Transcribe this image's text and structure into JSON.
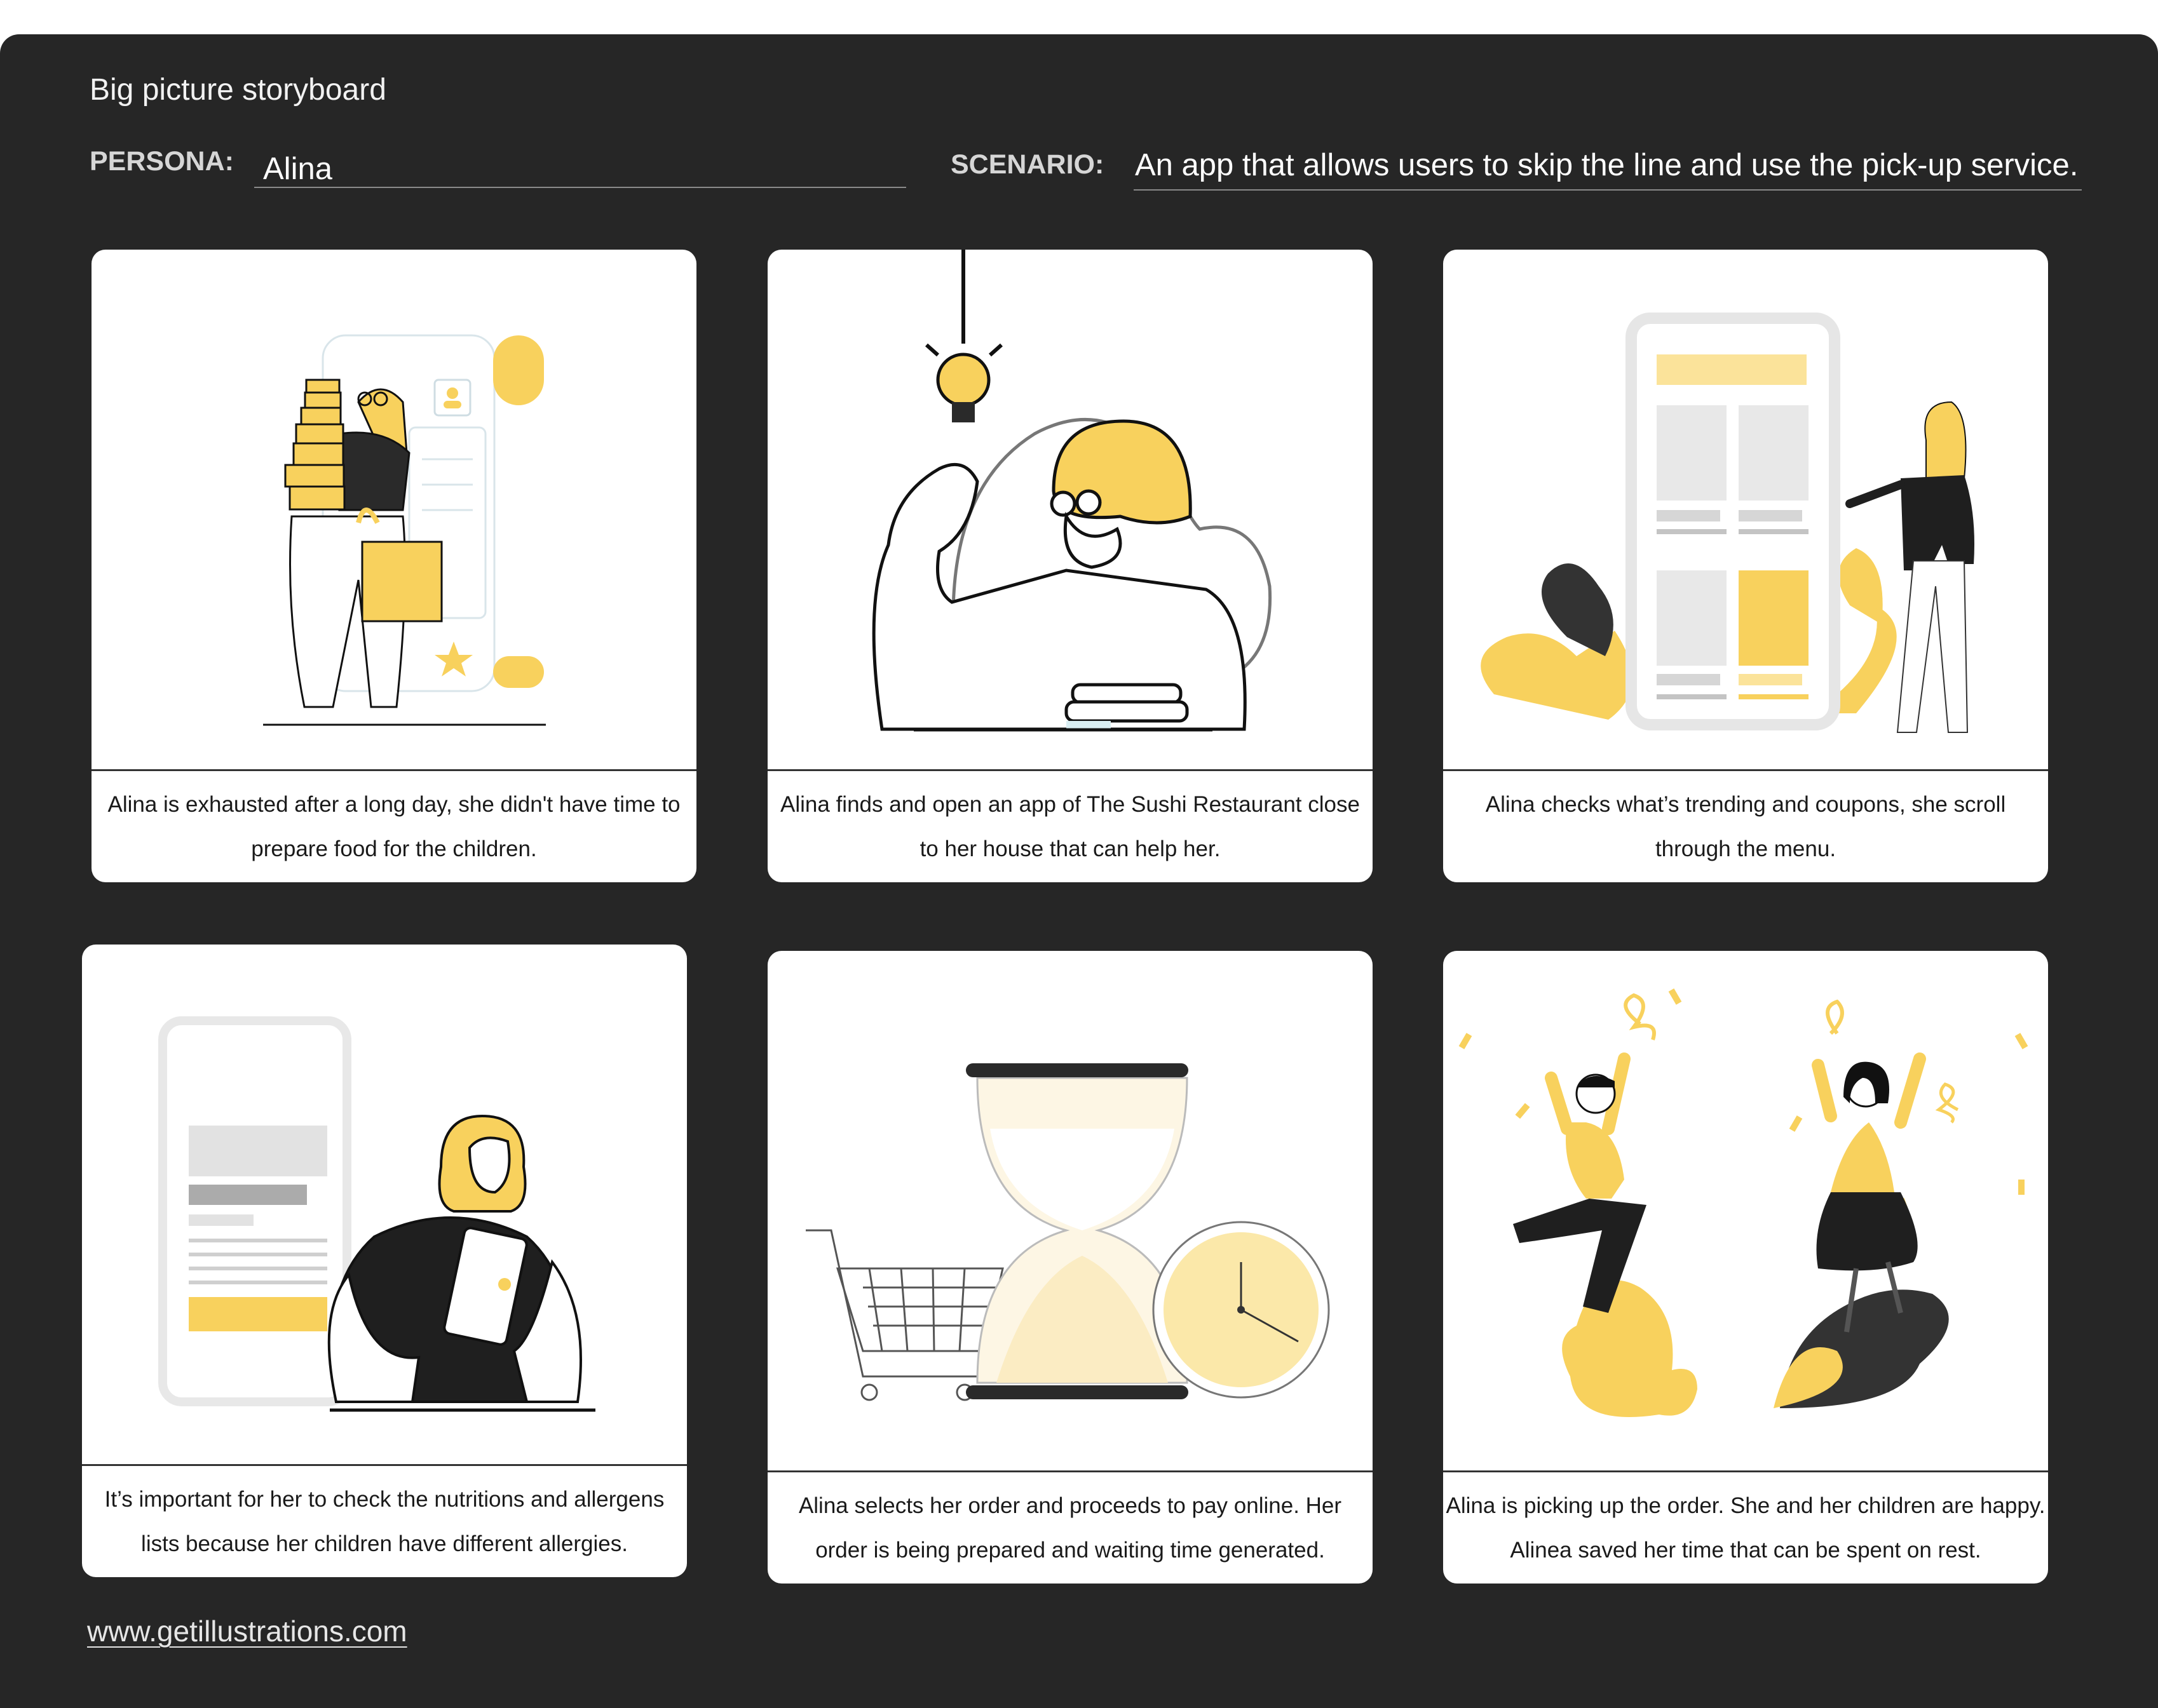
{
  "title": "Big picture storyboard",
  "persona": {
    "label": "PERSONA:",
    "value": "Alina"
  },
  "scenario": {
    "label": "SCENARIO:",
    "value": "An app that allows users to skip the line and use the pick-up service."
  },
  "panels": [
    {
      "caption": "Alina is exhausted after a long day, she didn't have time to prepare food for the children."
    },
    {
      "caption": "Alina finds and open an app of The Sushi Restaurant close to her house that can help her."
    },
    {
      "caption": "Alina checks what’s trending and coupons, she scroll through the menu."
    },
    {
      "caption": "It’s important for her to check the nutritions and allergens lists because her children have different allergies."
    },
    {
      "caption": "Alina selects her order and proceeds to pay online. Her order is being prepared and waiting time generated."
    },
    {
      "caption": "Alina is picking up the order. She and her children are happy. Alinea saved her time that can be spent on rest."
    }
  ],
  "footer": {
    "link": "www.getillustrations.com"
  },
  "colors": {
    "background": "#262626",
    "accent": "#f8d15d",
    "card": "#ffffff"
  }
}
